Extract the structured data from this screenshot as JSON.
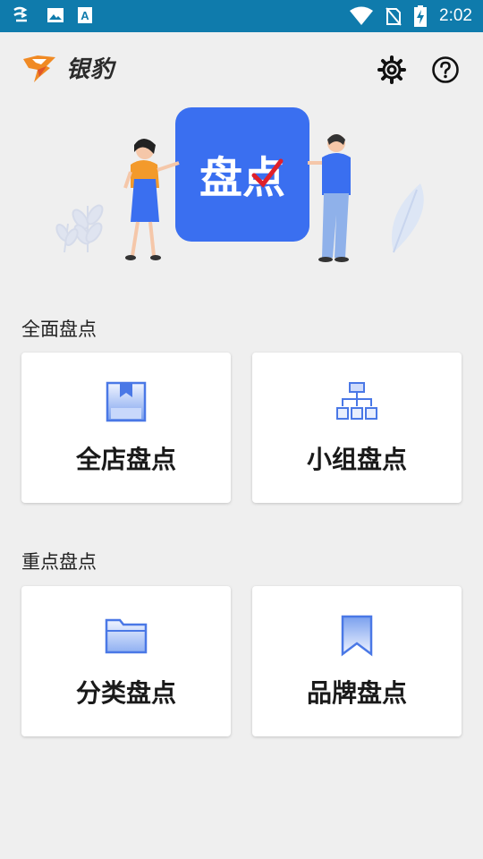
{
  "status_bar": {
    "time": "2:02",
    "left_icons": [
      "cast-icon",
      "image-icon",
      "a-box-icon"
    ],
    "right_icons": [
      "wifi-icon",
      "no-sim-icon",
      "battery-charging-icon"
    ],
    "background": "#0f7bac"
  },
  "app_bar": {
    "brand": "银豹",
    "settings_icon": "gear-icon",
    "help_icon": "question-circle-icon"
  },
  "hero": {
    "badge_text": "盘点",
    "accent": "#3a6ff0"
  },
  "sections": [
    {
      "title": "全面盘点",
      "items": [
        {
          "label": "全店盘点",
          "icon": "box-icon"
        },
        {
          "label": "小组盘点",
          "icon": "org-chart-icon"
        }
      ]
    },
    {
      "title": "重点盘点",
      "items": [
        {
          "label": "分类盘点",
          "icon": "folder-icon"
        },
        {
          "label": "品牌盘点",
          "icon": "bookmark-icon"
        }
      ]
    }
  ]
}
